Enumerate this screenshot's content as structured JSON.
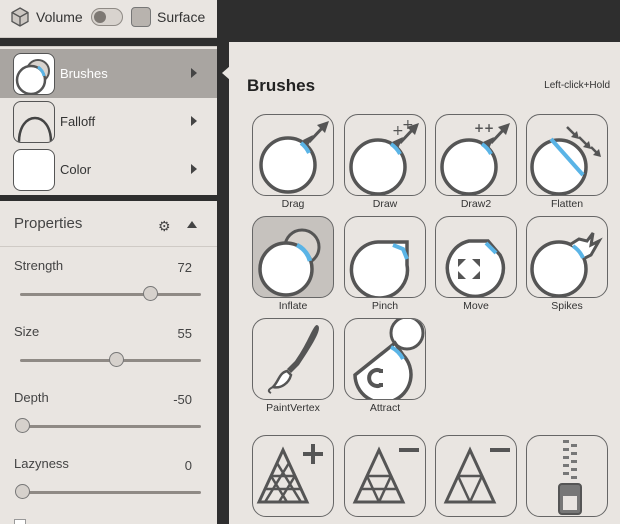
{
  "topbar": {
    "volume_label": "Volume",
    "surface_label": "Surface"
  },
  "menu": {
    "items": [
      {
        "label": "Brushes",
        "active": true
      },
      {
        "label": "Falloff",
        "active": false
      },
      {
        "label": "Color",
        "active": false
      }
    ]
  },
  "properties": {
    "title": "Properties",
    "sliders": [
      {
        "label": "Strength",
        "value": "72",
        "fraction": 0.72
      },
      {
        "label": "Size",
        "value": "55",
        "fraction": 0.53
      },
      {
        "label": "Depth",
        "value": "-50",
        "fraction": 0.0
      },
      {
        "label": "Lazyness",
        "value": "0",
        "fraction": 0.0
      }
    ]
  },
  "panel": {
    "title": "Brushes",
    "hint": "Left-click+Hold",
    "brushes": [
      {
        "label": "Drag",
        "icon": "drag-icon"
      },
      {
        "label": "Draw",
        "icon": "draw-icon"
      },
      {
        "label": "Draw2",
        "icon": "draw2-icon"
      },
      {
        "label": "Flatten",
        "icon": "flatten-icon"
      },
      {
        "label": "Inflate",
        "icon": "inflate-icon",
        "selected": true
      },
      {
        "label": "Pinch",
        "icon": "pinch-icon"
      },
      {
        "label": "Move",
        "icon": "move-icon"
      },
      {
        "label": "Spikes",
        "icon": "spikes-icon"
      },
      {
        "label": "PaintVertex",
        "icon": "paint-brush-icon"
      },
      {
        "label": "Attract",
        "icon": "magnet-icon"
      },
      {
        "label": "",
        "icon": "triangle-plus-icon"
      },
      {
        "label": "",
        "icon": "triangle-minus-icon"
      },
      {
        "label": "",
        "icon": "triangle-minus-coarse-icon"
      },
      {
        "label": "",
        "icon": "zipper-icon"
      }
    ]
  },
  "colors": {
    "accent": "#5ab4e6",
    "outline": "#555555",
    "panel_bg": "#e9e5e1",
    "dark_bg": "#2e2e2e"
  }
}
